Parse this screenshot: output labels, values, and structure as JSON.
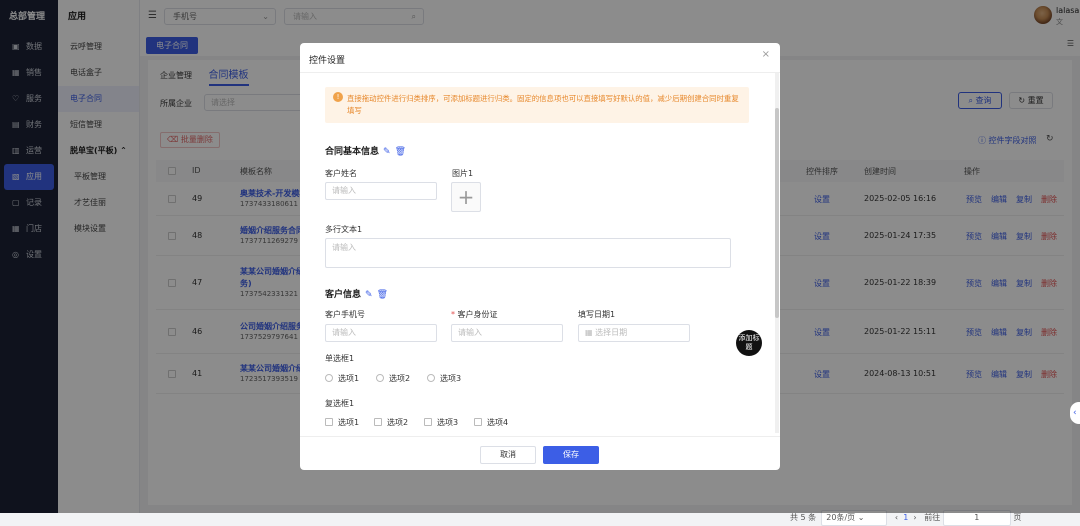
{
  "nav": {
    "brand": "总部管理",
    "items": [
      {
        "icon": "monitor-icon",
        "glyph": "▣",
        "label": "数据"
      },
      {
        "icon": "grid-icon",
        "glyph": "▦",
        "label": "销售"
      },
      {
        "icon": "heart-icon",
        "glyph": "♡",
        "label": "服务"
      },
      {
        "icon": "wallet-icon",
        "glyph": "▤",
        "label": "财务"
      },
      {
        "icon": "chart-icon",
        "glyph": "▥",
        "label": "运营"
      },
      {
        "icon": "apps-icon",
        "glyph": "▧",
        "label": "应用"
      },
      {
        "icon": "doc-icon",
        "glyph": "▢",
        "label": "记录"
      },
      {
        "icon": "store-icon",
        "glyph": "▦",
        "label": "门店"
      },
      {
        "icon": "settings-icon",
        "glyph": "◎",
        "label": "设置"
      }
    ]
  },
  "subnav": {
    "title": "应用",
    "items": [
      "云呼管理",
      "电话盒子",
      "电子合同",
      "短信管理"
    ],
    "group": "脱单宝(平板)",
    "group_chevron": "⌃",
    "group_items": [
      "平板管理",
      "才艺佳丽",
      "模块设置"
    ]
  },
  "topbar": {
    "menu_icon": "☰",
    "select_value": "手机号",
    "search_placeholder": "请输入",
    "username": "lalasand",
    "user_role": "文"
  },
  "page": {
    "tab": "电子合同",
    "subtabs": [
      "企业管理",
      "合同模板"
    ],
    "filter_label": "所属企业",
    "filter_placeholder": "请选择",
    "query_label": "查询",
    "reset_label": "重置",
    "bulk_delete": "批量删除",
    "field_map": "控件字段对照"
  },
  "table": {
    "headers": {
      "id": "ID",
      "name": "模板名称",
      "sort": "控件排序",
      "created": "创建时间",
      "ops": "操作"
    },
    "rows": [
      {
        "id": "49",
        "name": "奥莱技术-开发模板",
        "sub": "1737433180611",
        "sort": "设置",
        "created": "2025-02-05 16:16"
      },
      {
        "id": "48",
        "name": "婚姻介绍服务合同",
        "sub": "1737711269279",
        "sort": "设置",
        "created": "2025-01-24 17:35"
      },
      {
        "id": "47",
        "name": "某某公司婚姻介绍服",
        "name2": "务)",
        "sub": "1737542331321",
        "sort": "设置",
        "created": "2025-01-22 18:39"
      },
      {
        "id": "46",
        "name": "公司婚姻介绍服务合",
        "sub": "1737529797641",
        "sort": "设置",
        "created": "2025-01-22 15:11"
      },
      {
        "id": "41",
        "name": "某某公司婚姻介绍服",
        "sub": "1723517393519",
        "sort": "设置",
        "created": "2024-08-13 10:51"
      }
    ],
    "ops": [
      "预览",
      "编辑",
      "复制",
      "删除"
    ]
  },
  "pager": {
    "total": "共 5 条",
    "size": "20条/页",
    "current": "1",
    "goto": "前往",
    "goto_value": "1",
    "page_unit": "页"
  },
  "modal": {
    "title": "控件设置",
    "close": "×",
    "alert": "直接拖动控件进行归类排序，可添加标题进行归类。固定的信息项也可以直接填写好默认的值，减少后期创建合同时重复填写",
    "section1": "合同基本信息",
    "customer_name_label": "客户姓名",
    "customer_name_ph": "请输入",
    "image_label": "图片1",
    "multiline_label": "多行文本1",
    "multiline_ph": "请输入",
    "section2": "客户信息",
    "phone_label": "客户手机号",
    "phone_ph": "请输入",
    "idcard_label": "客户身份证",
    "idcard_ph": "请输入",
    "date_label": "填写日期1",
    "date_ph": "选择日期",
    "radio_label": "单选框1",
    "radio_options": [
      "选项1",
      "选项2",
      "选项3"
    ],
    "checkbox_label": "复选框1",
    "checkbox_options": [
      "选项1",
      "选项2",
      "选项3",
      "选项4"
    ],
    "add_title": "添加标题",
    "cancel": "取消",
    "save": "保存"
  }
}
